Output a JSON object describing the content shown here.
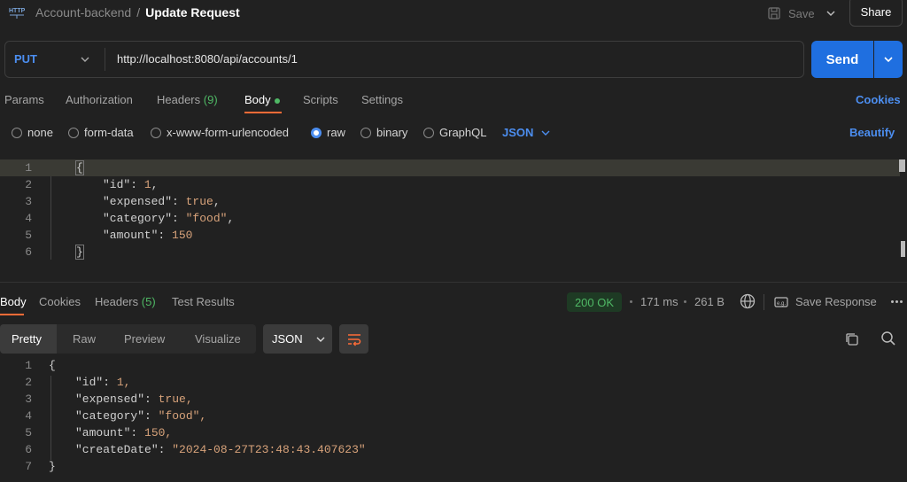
{
  "header": {
    "collection": "Account-backend",
    "separator": "/",
    "request_name": "Update Request",
    "save_label": "Save",
    "share_label": "Share"
  },
  "request": {
    "method": "PUT",
    "url": "http://localhost:8080/api/accounts/1",
    "send_label": "Send"
  },
  "tabs": {
    "params": "Params",
    "authorization": "Authorization",
    "headers": "Headers",
    "headers_count": "(9)",
    "body": "Body",
    "scripts": "Scripts",
    "settings": "Settings",
    "cookies": "Cookies"
  },
  "body_options": {
    "none": "none",
    "form_data": "form-data",
    "urlencoded": "x-www-form-urlencoded",
    "raw": "raw",
    "binary": "binary",
    "graphql": "GraphQL",
    "format": "JSON",
    "beautify": "Beautify",
    "selected": "raw"
  },
  "request_body": {
    "line_numbers": [
      "1",
      "2",
      "3",
      "4",
      "5",
      "6"
    ],
    "open": "{",
    "close": "}",
    "id_key": "\"id\"",
    "id_val": "1",
    "expensed_key": "\"expensed\"",
    "expensed_val": "true",
    "category_key": "\"category\"",
    "category_val": "\"food\"",
    "amount_key": "\"amount\"",
    "amount_val": "150"
  },
  "response": {
    "tabs": {
      "body": "Body",
      "cookies": "Cookies",
      "headers": "Headers",
      "headers_count": "(5)",
      "test_results": "Test Results"
    },
    "status": "200 OK",
    "time": "171 ms",
    "size": "261 B",
    "save_response": "Save Response",
    "views": {
      "pretty": "Pretty",
      "raw": "Raw",
      "preview": "Preview",
      "visualize": "Visualize"
    },
    "format": "JSON",
    "line_numbers": [
      "1",
      "2",
      "3",
      "4",
      "5",
      "6",
      "7"
    ],
    "open": "{",
    "close": "}",
    "id_key": "\"id\"",
    "id_val": "1,",
    "expensed_key": "\"expensed\"",
    "expensed_val": "true,",
    "category_key": "\"category\"",
    "category_val": "\"food\",",
    "amount_key": "\"amount\"",
    "amount_val": "150,",
    "createdate_key": "\"createDate\"",
    "createdate_val": "\"2024-08-27T23:48:43.407623\""
  },
  "colors": {
    "accent_blue": "#1f6fe0",
    "link_blue": "#4c8ef0",
    "success_green": "#4fb865",
    "active_underline": "#ff6c37"
  }
}
